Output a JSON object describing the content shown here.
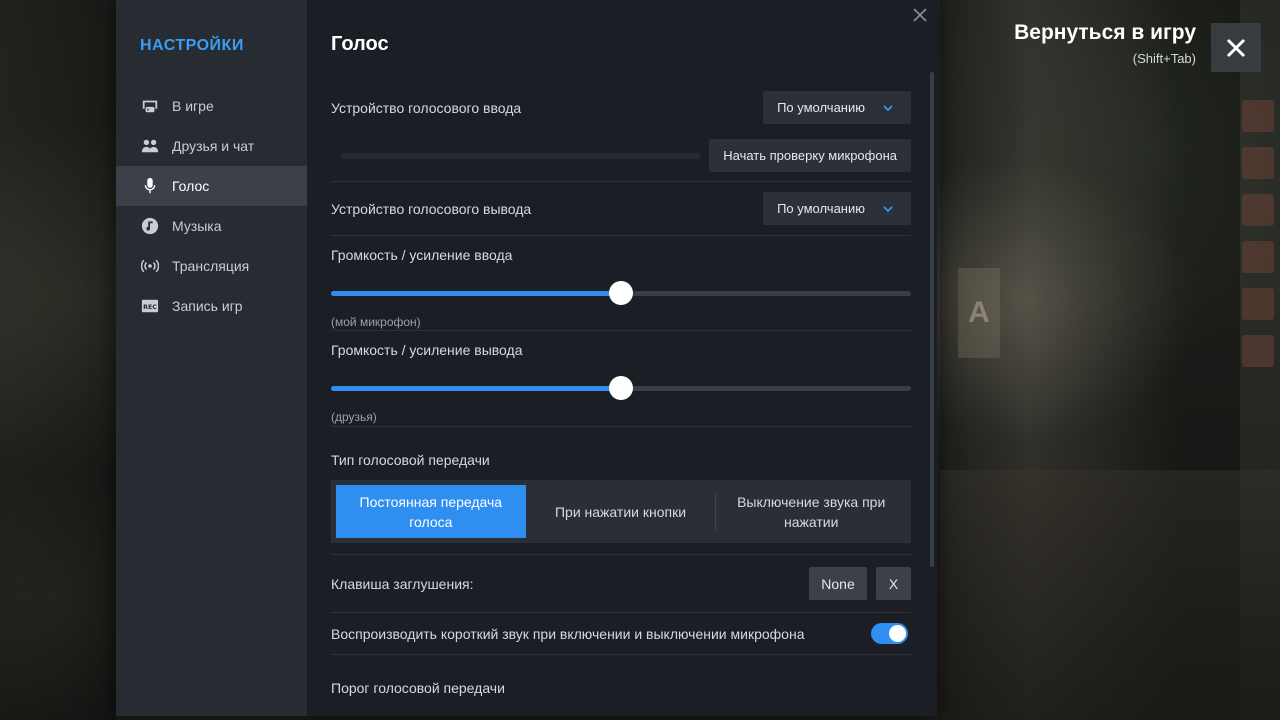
{
  "sidebar": {
    "title": "НАСТРОЙКИ",
    "items": [
      {
        "label": "В игре",
        "icon": "gamepad-monitor-icon"
      },
      {
        "label": "Друзья и чат",
        "icon": "people-icon"
      },
      {
        "label": "Голос",
        "icon": "microphone-icon",
        "active": true
      },
      {
        "label": "Музыка",
        "icon": "music-note-icon"
      },
      {
        "label": "Трансляция",
        "icon": "broadcast-icon"
      },
      {
        "label": "Запись игр",
        "icon": "rec-icon"
      }
    ]
  },
  "page": {
    "title": "Голос"
  },
  "voice": {
    "input_device_label": "Устройство голосового ввода",
    "input_device_value": "По умолчанию",
    "mic_test_button": "Начать проверку микрофона",
    "output_device_label": "Устройство голосового вывода",
    "output_device_value": "По умолчанию",
    "input_volume_label": "Громкость / усиление ввода",
    "input_volume_caption": "(мой микрофон)",
    "input_volume_level": 0.5,
    "output_volume_label": "Громкость / усиление вывода",
    "output_volume_caption": "(друзья)",
    "output_volume_level": 0.5,
    "transmission_type_label": "Тип голосовой передачи",
    "transmission_options": [
      {
        "label": "Постоянная передача голоса",
        "active": true
      },
      {
        "label": "При нажатии кнопки",
        "active": false
      },
      {
        "label": "Выключение звука при нажатии",
        "active": false
      }
    ],
    "mute_key_label": "Клавиша заглушения:",
    "mute_key_value": "None",
    "mute_key_clear": "X",
    "sound_on_toggle_label": "Воспроизводить короткий звук при включении и выключении микрофона",
    "sound_on_toggle_value": true,
    "threshold_label": "Порог голосовой передачи"
  },
  "overlay": {
    "return_title": "Вернуться в игру",
    "return_hotkey": "(Shift+Tab)"
  },
  "colors": {
    "accent": "#2f8ff0",
    "sidebar_title": "#3a9df2",
    "panel_bg": "#1b1f25",
    "sidebar_bg": "#272b32"
  }
}
